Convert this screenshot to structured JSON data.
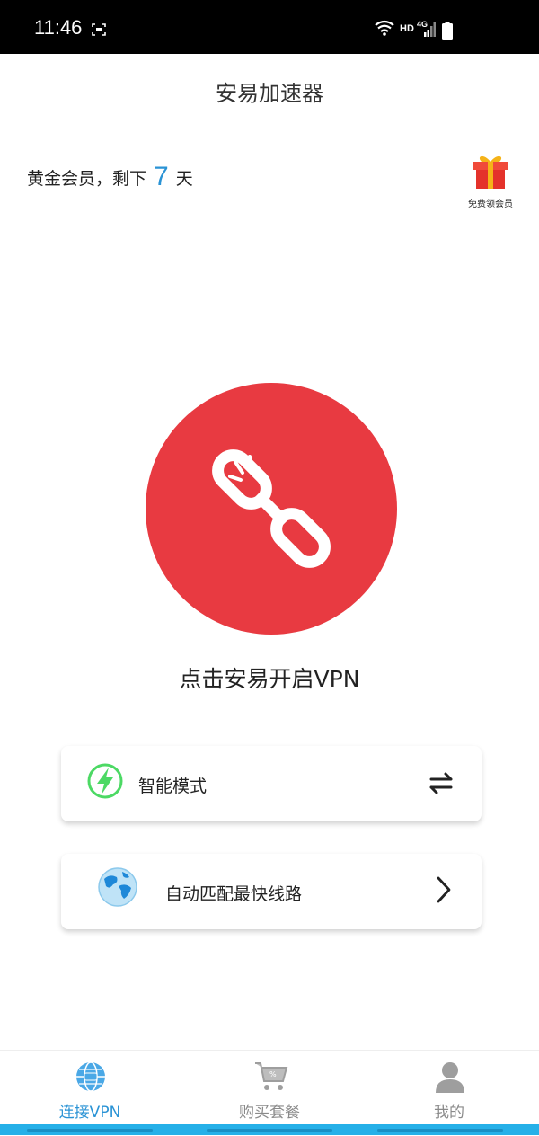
{
  "status_bar": {
    "time": "11:46",
    "hd_label": "HD",
    "network_label": "4G"
  },
  "header": {
    "title": "安易加速器"
  },
  "membership": {
    "prefix": "黄金会员，剩下",
    "days": "7",
    "suffix": "天",
    "gift_label": "免费领会员"
  },
  "connect": {
    "label": "点击安易开启VPN",
    "color": "#e83a41"
  },
  "cards": {
    "mode_label": "智能模式",
    "route_label": "自动匹配最快线路"
  },
  "tabs": [
    {
      "label": "连接VPN",
      "active": true
    },
    {
      "label": "购买套餐",
      "active": false
    },
    {
      "label": "我的",
      "active": false
    }
  ],
  "colors": {
    "accent": "#2a93d5",
    "connect_red": "#e83a41",
    "bolt_green": "#4cd964"
  }
}
